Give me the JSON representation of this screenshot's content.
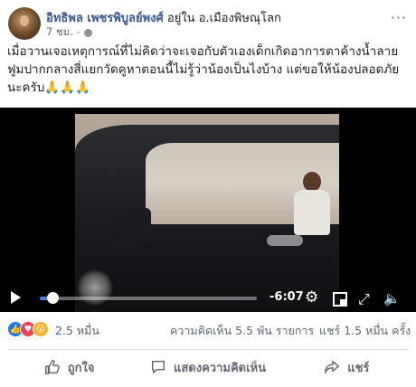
{
  "post": {
    "author": "อิทธิพล เพชรพิบูลย์พงศ์",
    "location_text": " อยู่ใน อ.เมืองพิษณุโลก",
    "time": "7 ชม.",
    "more_label": "···",
    "text": "เมื่อวานเจอเหตุการณ์ที่ไม่คิดว่าจะเจอกับตัวเองเด็กเกิดอาการตาค้างน้ำลายฟูมปากกลางสี่แยกวัดคูหาตอนนี้ไม่รู้ว่าน้องเป็นไงบ้าง แต่ขอให้น้องปลอดภัยนะครับ🙏🙏🙏"
  },
  "video": {
    "progress": 0.06,
    "time_remaining": "-6:07",
    "icons": [
      "play-icon",
      "settings-icon",
      "pip-icon",
      "fullscreen-icon",
      "volume-icon"
    ]
  },
  "stats": {
    "reactions": "2.5 หมื่น",
    "comments": "ความคิดเห็น 5.5 พัน รายการ",
    "shares": "แชร์ 1.5 หมื่น ครั้ง"
  },
  "actions": {
    "like": "ถูกใจ",
    "comment": "แสดงความคิดเห็น",
    "share": "แชร์"
  },
  "colors": {
    "name": "#385898",
    "accent": "#4b7de3",
    "like": "#1877f2",
    "love": "#f33e58",
    "wow": "#f7b125"
  }
}
